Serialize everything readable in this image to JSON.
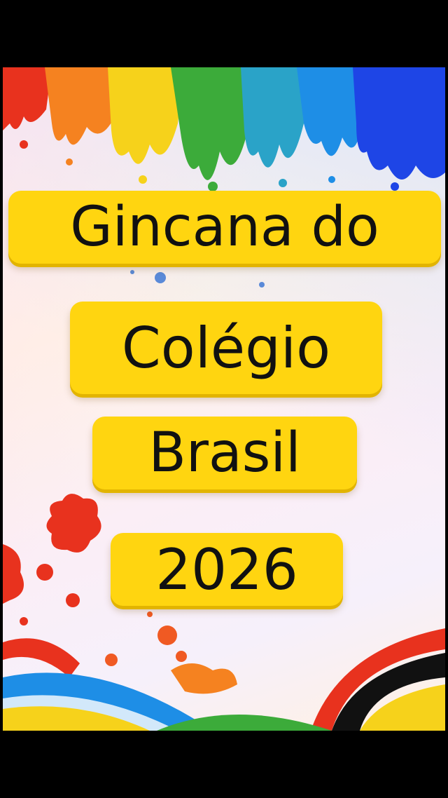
{
  "poster": {
    "line1": "Gincana do",
    "line2": "Colégio",
    "line3": "Brasil",
    "line4": "2026"
  },
  "colors": {
    "banner_fill": "#ffd510",
    "text": "#111111",
    "paint_red": "#e8321e",
    "paint_orange": "#f58220",
    "paint_yellow": "#f6d21b",
    "paint_green": "#3cab3a",
    "paint_blue": "#1e64e6"
  }
}
